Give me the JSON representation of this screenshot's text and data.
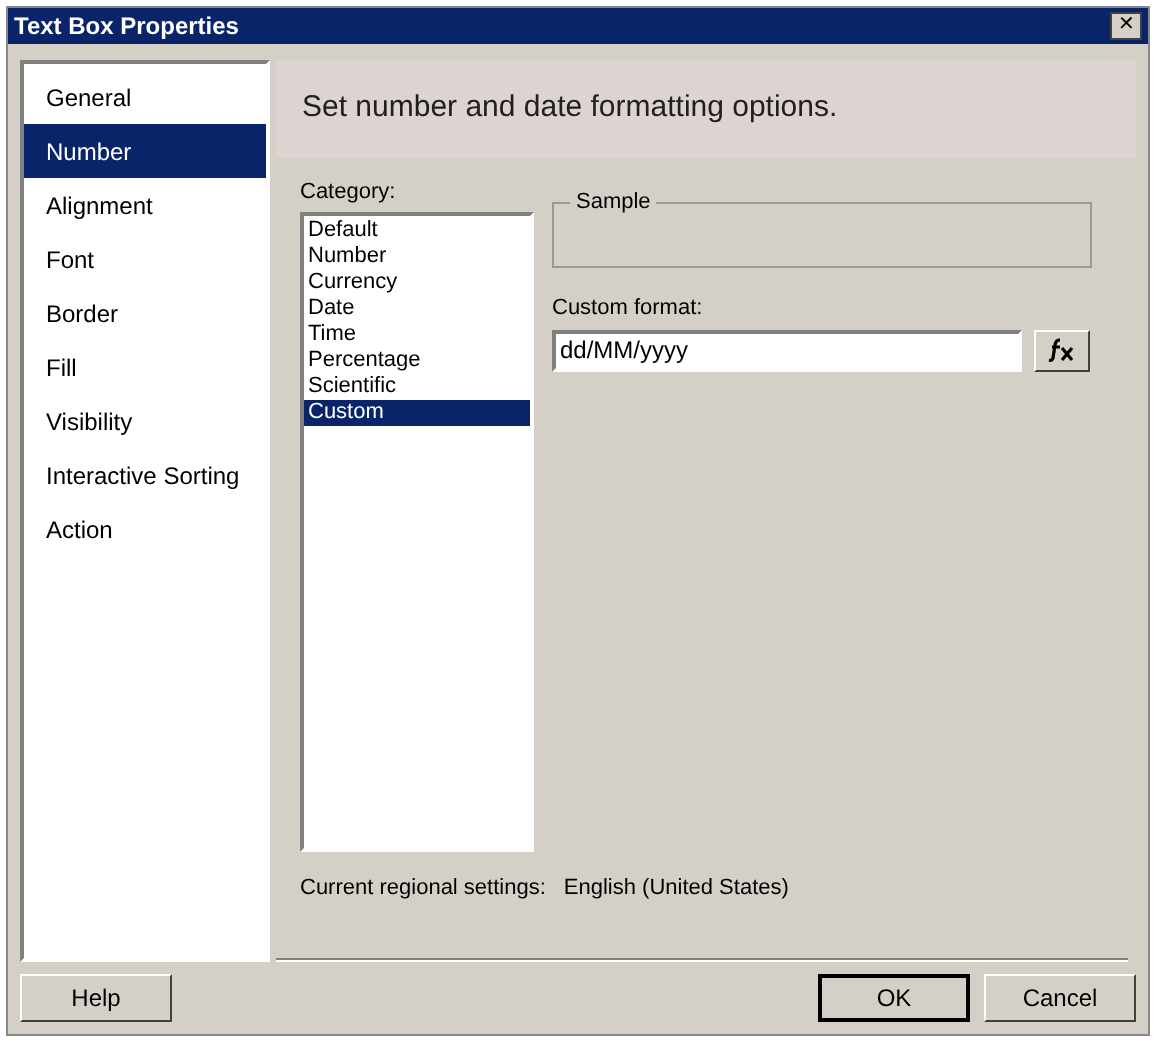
{
  "window": {
    "title": "Text Box Properties",
    "close": "✕"
  },
  "sidebar": {
    "items": [
      {
        "label": "General",
        "selected": false
      },
      {
        "label": "Number",
        "selected": true
      },
      {
        "label": "Alignment",
        "selected": false
      },
      {
        "label": "Font",
        "selected": false
      },
      {
        "label": "Border",
        "selected": false
      },
      {
        "label": "Fill",
        "selected": false
      },
      {
        "label": "Visibility",
        "selected": false
      },
      {
        "label": "Interactive Sorting",
        "selected": false
      },
      {
        "label": "Action",
        "selected": false
      }
    ]
  },
  "header": "Set number and date formatting options.",
  "category": {
    "label": "Category:",
    "items": [
      {
        "label": "Default",
        "selected": false
      },
      {
        "label": "Number",
        "selected": false
      },
      {
        "label": "Currency",
        "selected": false
      },
      {
        "label": "Date",
        "selected": false
      },
      {
        "label": "Time",
        "selected": false
      },
      {
        "label": "Percentage",
        "selected": false
      },
      {
        "label": "Scientific",
        "selected": false
      },
      {
        "label": "Custom",
        "selected": true
      }
    ]
  },
  "sample": {
    "label": "Sample"
  },
  "custom_format": {
    "label": "Custom format:",
    "value": "dd/MM/yyyy"
  },
  "regional": {
    "label": "Current regional settings:",
    "value": "English (United States)"
  },
  "buttons": {
    "help": "Help",
    "ok": "OK",
    "cancel": "Cancel"
  }
}
